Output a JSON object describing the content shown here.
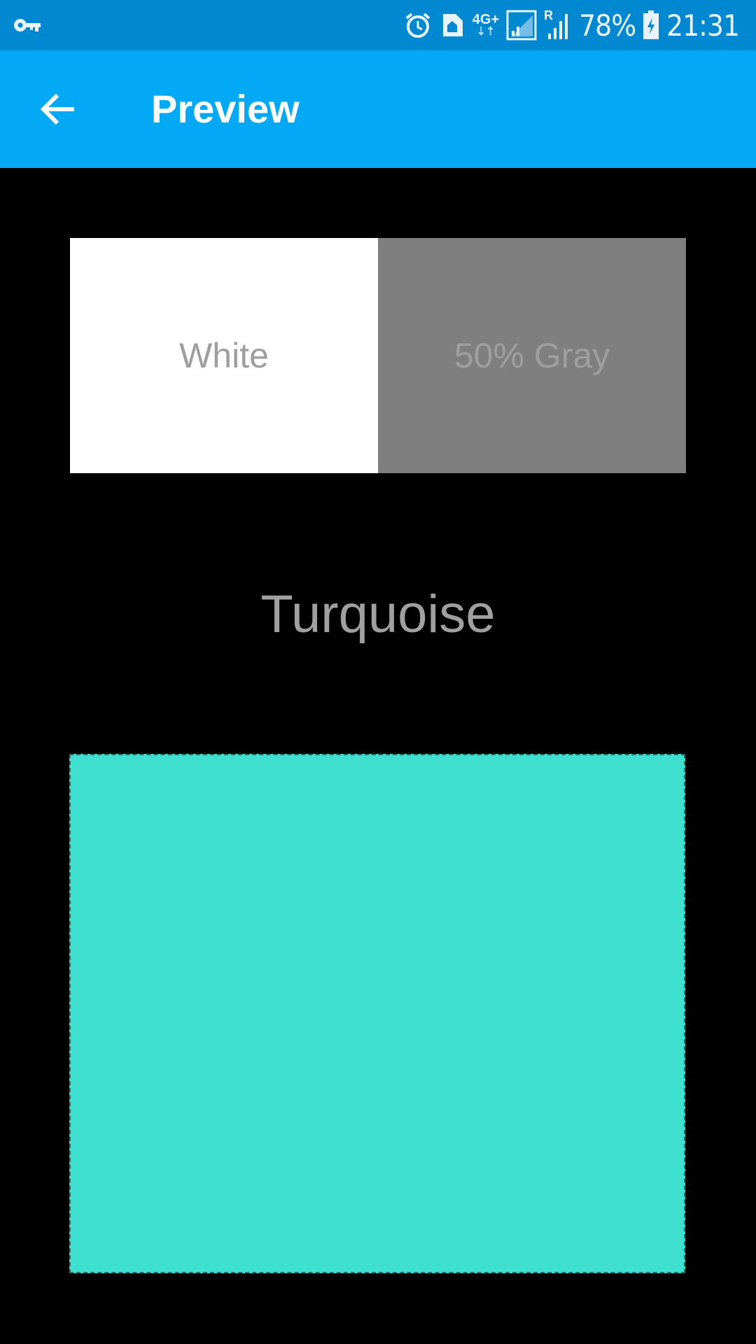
{
  "status_bar": {
    "icons": [
      "vpn-key-icon",
      "alarm-icon",
      "home-notification-icon",
      "network-4g-plus-icon",
      "signal-icon",
      "roaming-signal-icon",
      "battery-charging-icon"
    ],
    "network_type": "4G+",
    "roaming_indicator": "R",
    "battery_percent": "78%",
    "time": "21:31",
    "background_color": "#0288d1"
  },
  "app_bar": {
    "title": "Preview",
    "back_icon": "arrow-back-icon",
    "background_color": "#03a9f4"
  },
  "swatches": [
    {
      "label": "White",
      "color": "#ffffff"
    },
    {
      "label": "50% Gray",
      "color": "#7f7f7f"
    }
  ],
  "preview": {
    "color_name": "Turquoise",
    "color": "#40e0d0"
  }
}
